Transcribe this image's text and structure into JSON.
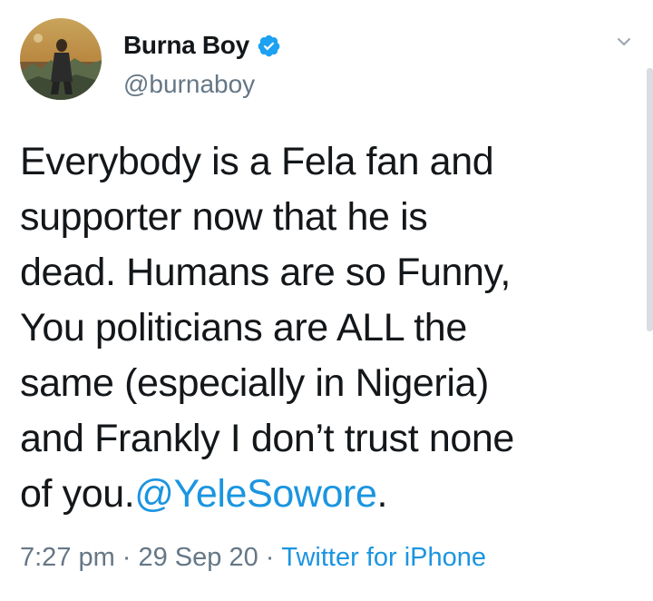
{
  "author": {
    "display_name": "Burna Boy",
    "handle": "@burnaboy",
    "verified": true
  },
  "tweet": {
    "text_before_mention": "Everybody is a Fela fan and\nsupporter now that he is\ndead. Humans are so Funny,\nYou politicians are ALL the\nsame (especially in Nigeria)\nand Frankly I don’t trust none\nof you.",
    "mention": "@YeleSowore",
    "text_after_mention": "."
  },
  "meta": {
    "time": "7:27 pm",
    "separator": "·",
    "date": "29 Sep 20",
    "source": "Twitter for iPhone"
  },
  "icons": {
    "verified": "verified-badge-icon",
    "menu": "chevron-down-icon"
  },
  "colors": {
    "link": "#1b95e0",
    "secondary_text": "#657786",
    "primary_text": "#14171a"
  }
}
